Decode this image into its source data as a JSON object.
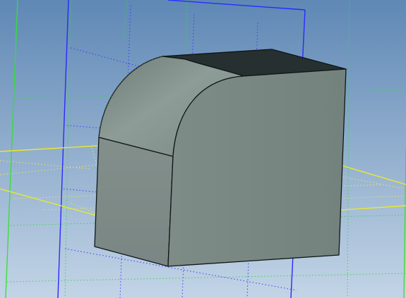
{
  "viewport": {
    "background_top": "#5f88b5",
    "background_bottom": "#c3d4e6"
  },
  "planes": {
    "yz_plane_color": "#2a2aff",
    "xz_plane_color": "#33e033",
    "xy_plane_color": "#e8ea2a",
    "grid_dotted_colors": [
      "#3b3bff",
      "#37d64a",
      "#e6e85e"
    ]
  },
  "solid": {
    "top_face_color": "#263030",
    "front_face_color": "#7b8985",
    "side_face_color": "#7a8883",
    "fillet_color": "#8a9994",
    "edge_color": "#101616"
  }
}
